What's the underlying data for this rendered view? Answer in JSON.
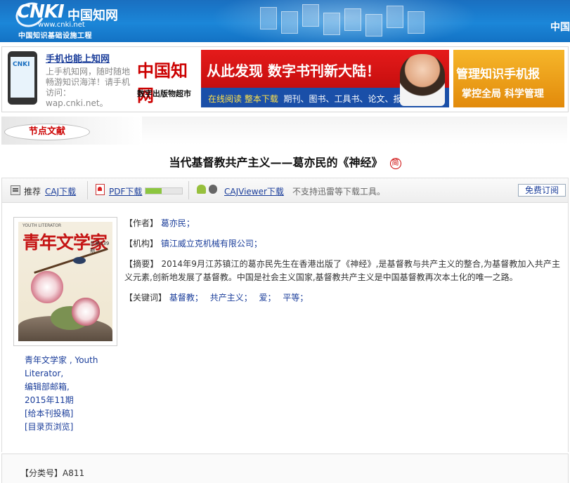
{
  "header": {
    "logo_text": "CNKI",
    "logo_cn": "中国知网",
    "logo_url": "www.cnki.net",
    "logo_sub": "中国知识基础设施工程",
    "right_text": "中国"
  },
  "mobile_promo": {
    "phone_logo": "CNKI",
    "title": "手机也能上知网",
    "desc": "上手机知网，随时随地畅游知识海洋！请手机访问：wap.cnki.net。"
  },
  "banner_digital": {
    "brand": "中国知网",
    "brand_sub": "数字出版物超市",
    "slogan": "从此发现 数字书刊新大陆！",
    "sub_highlight": "在线阅读  整本下载",
    "sub_rest": "期刊、图书、工具书、论文、报纸"
  },
  "banner_mgmt": {
    "line1": "管理知识手机报",
    "line2": "掌控全局 科学管理"
  },
  "section_tab": "节点文献",
  "article": {
    "title": "当代基督教共产主义——葛亦民的《神经》",
    "simplified_badge": "简"
  },
  "download_bar": {
    "recommend_label": "推荐",
    "caj_download": "CAJ下载",
    "pdf_download": "PDF下载",
    "pdf_progress_percent": 45,
    "cajviewer_download": "CAJViewer下载",
    "note": "不支持迅雷等下载工具。",
    "subscribe_button": "免费订阅"
  },
  "cover": {
    "youth_text": "YOUTH LITERATOR",
    "mag_title": "青年文学家",
    "issue": "总第539期"
  },
  "journal_info": {
    "name_cn": "青年文学家",
    "name_en_part1": " , Youth",
    "name_en_part2": "Literator,",
    "editorial_mailbox": "编辑部邮箱,",
    "issue": "2015年11期",
    "submit_link": "[给本刊投稿]",
    "toc_link": "[目录页浏览]"
  },
  "meta": {
    "author_label": "【作者】",
    "author_value": "葛亦民；",
    "org_label": "【机构】",
    "org_value": "镇江威立克机械有限公司；",
    "abstract_label": "【摘要】",
    "abstract_text": "2014年9月江苏镇江的葛亦民先生在香港出版了《神经》,是基督教与共产主义的整合,为基督教加入共产主义元素,创新地发展了基督教。中国是社会主义国家,基督教共产主义是中国基督教再次本土化的唯一之路。",
    "keywords_label": "【关键词】",
    "keywords": [
      "基督教；",
      "共产主义；",
      "爱；",
      "平等；"
    ]
  },
  "classification": {
    "label": "【分类号】",
    "value": "A811"
  },
  "colors": {
    "header_blue": "#1b86d8",
    "link_blue": "#1a3d9a",
    "accent_red": "#c00000"
  }
}
